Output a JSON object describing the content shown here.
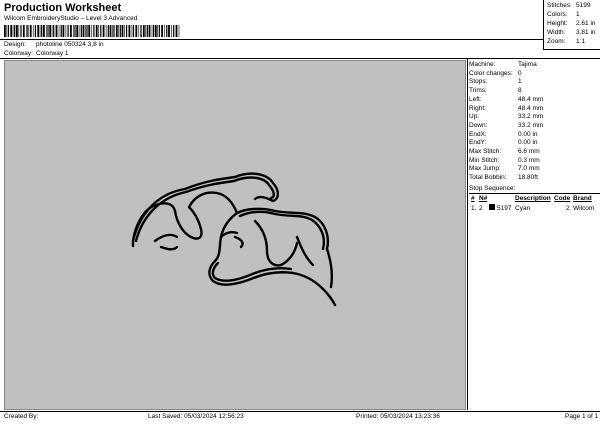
{
  "header": {
    "title": "Production Worksheet",
    "subtitle": "Wilcom EmbroideryStudio – Level 3 Advanced",
    "barcode_suffix": ",",
    "design_label": "Design:",
    "design_value": "photoline 050324 3,8 in",
    "colorway_label": "Colorway:",
    "colorway_value": "Colorway 1"
  },
  "stats": {
    "stitches_label": "Stitches:",
    "stitches_value": "5199",
    "colors_label": "Colors:",
    "colors_value": "1",
    "height_label": "Height:",
    "height_value": "2.61 in",
    "width_label": "Width:",
    "width_value": "3.81 in",
    "zoom_label": "Zoom:",
    "zoom_value": "1:1"
  },
  "machine": {
    "rows": [
      {
        "label": "Machine:",
        "value": "Tajima"
      },
      {
        "label": "Color changes:",
        "value": "0"
      },
      {
        "label": "Stops:",
        "value": "1"
      },
      {
        "label": "Trims:",
        "value": "8"
      },
      {
        "label": "Left:",
        "value": "48.4 mm"
      },
      {
        "label": "Right:",
        "value": "48.4 mm"
      },
      {
        "label": "Up:",
        "value": "33.2 mm"
      },
      {
        "label": "Down:",
        "value": "33.2 mm"
      },
      {
        "label": "EndX:",
        "value": "0.00 in"
      },
      {
        "label": "EndY:",
        "value": "0.00 in"
      },
      {
        "label": "Max Stitch:",
        "value": "6.6 mm"
      },
      {
        "label": "Min Stitch:",
        "value": "0.3 mm"
      },
      {
        "label": "Max Jump:",
        "value": "7.0 mm"
      },
      {
        "label": "Total Bobbin:",
        "value": "18.80ft"
      }
    ]
  },
  "stop_sequence": {
    "title": "Stop Sequence:",
    "columns": [
      "#",
      "N#",
      "Description",
      "Code",
      "Brand"
    ],
    "rows": [
      {
        "index": "1.",
        "n": "2",
        "stitches": "5197",
        "description": "Cyan",
        "code": "2",
        "brand": "Wilcom",
        "color": "#000000"
      }
    ]
  },
  "footer": {
    "created_by": "Created By:",
    "last_saved": "Last Saved: 05/03/2024 12:56:23",
    "printed": "Printed: 05/03/2024 13:23:36",
    "page": "Page 1 of 1"
  },
  "colors": {
    "canvas_bg": "#c0c0c0",
    "thread": "#000000"
  }
}
